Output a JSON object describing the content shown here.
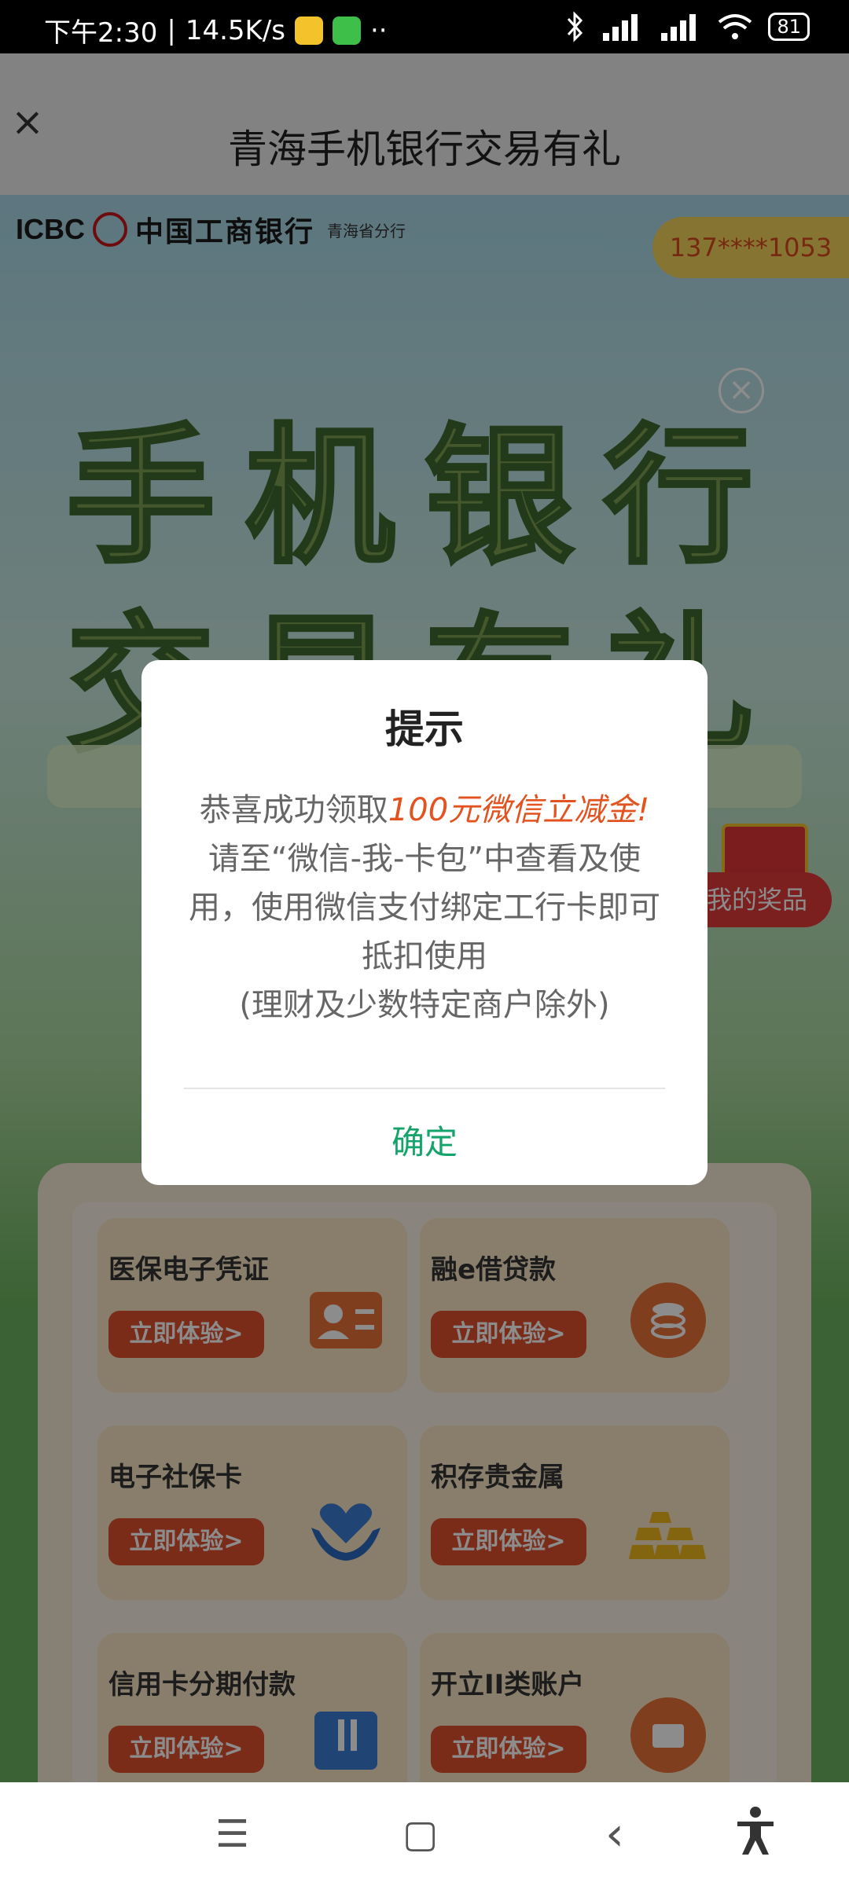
{
  "status_bar": {
    "time": "下午2:30",
    "speed": "14.5K/s",
    "dots": "··",
    "battery": "81"
  },
  "header": {
    "close_icon": "×",
    "title": "青海手机银行交易有礼"
  },
  "banner": {
    "brand_en": "ICBC",
    "brand_cn": "中国工商银行",
    "brand_sub": "青海省分行",
    "phone": "137****1053",
    "close_icon": "×",
    "hero_line1": "手机银行",
    "hero_line2": "交易有礼",
    "prize_label": "我的奖品"
  },
  "cards": [
    {
      "label": "医保电子凭证",
      "button": "立即体验>",
      "icon": "id-card-icon"
    },
    {
      "label": "融e借贷款",
      "button": "立即体验>",
      "icon": "coins-icon"
    },
    {
      "label": "电子社保卡",
      "button": "立即体验>",
      "icon": "heart-hands-icon"
    },
    {
      "label": "积存贵金属",
      "button": "立即体验>",
      "icon": "gold-bars-icon"
    },
    {
      "label": "信用卡分期付款",
      "button": "立即体验>",
      "icon": "card-icon"
    },
    {
      "label": "开立II类账户",
      "button": "立即体验>",
      "icon": "account-icon"
    }
  ],
  "dialog": {
    "title": "提示",
    "line1_prefix": "恭喜成功领取",
    "line1_highlight": "100元微信立减金!",
    "line2": "请至“微信-我-卡包”中查看及使用，使用微信支付绑定工行卡即可抵扣使用",
    "line3": "(理财及少数特定商户除外)",
    "confirm": "确定"
  },
  "nav_bar": {
    "menu": "☰",
    "home": "▢",
    "back": "‹",
    "accessibility": "accessibility-icon"
  },
  "colors": {
    "accent_red": "#e0502d",
    "highlight_orange": "#e2531f",
    "confirm_green": "#14a46b"
  }
}
